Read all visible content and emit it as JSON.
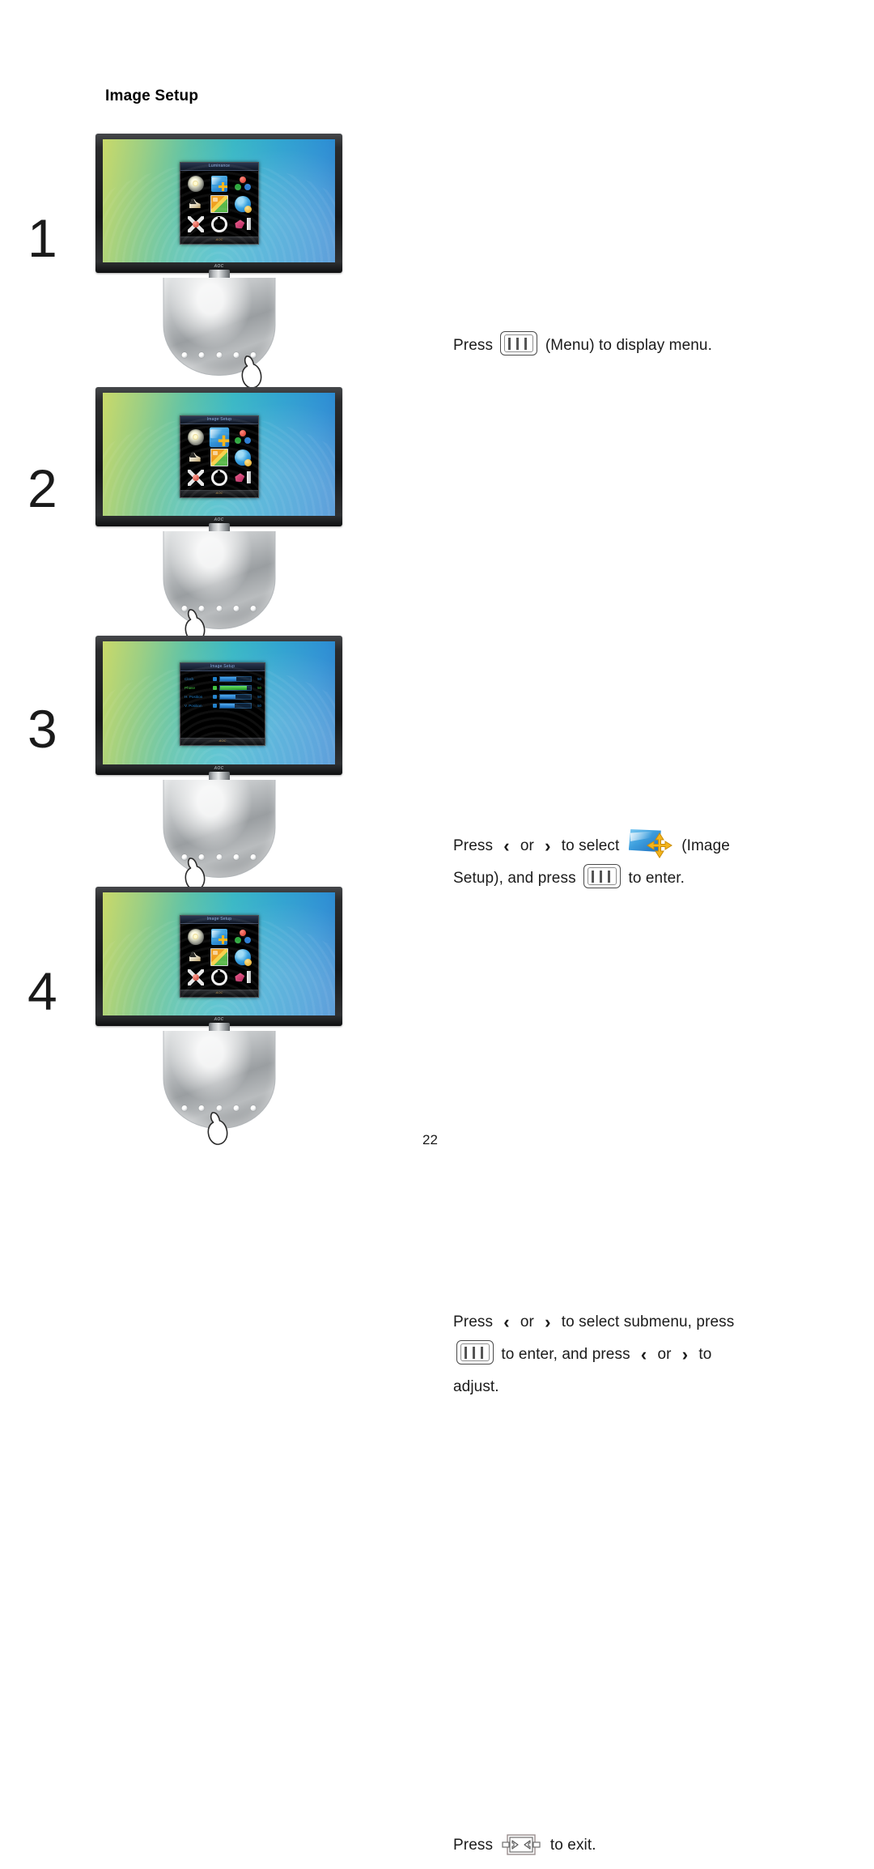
{
  "page": {
    "heading": "Image Setup",
    "number": "22"
  },
  "glyphs": {
    "menu_button": "menu-button-icon",
    "left_arrow": "‹",
    "right_arrow": "›",
    "exit_button": "exit-button-icon",
    "image_setup_icon": "image-setup-icon"
  },
  "steps": [
    {
      "number": "1",
      "lines": [
        [
          {
            "type": "text",
            "value": "Press"
          },
          {
            "type": "icon",
            "value": "menu-button-icon"
          },
          {
            "type": "text",
            "value": "(Menu) to display menu."
          }
        ]
      ],
      "monitor": {
        "osd_type": "icon-grid",
        "osd_title": "Luminance",
        "osd_footer": "AOC",
        "selected_index": -1
      }
    },
    {
      "number": "2",
      "lines": [
        [
          {
            "type": "text",
            "value": "Press"
          },
          {
            "type": "arrow",
            "value": "‹"
          },
          {
            "type": "text",
            "value": "or"
          },
          {
            "type": "arrow",
            "value": "›"
          },
          {
            "type": "text",
            "value": "to select"
          },
          {
            "type": "icon",
            "value": "image-setup-icon"
          },
          {
            "type": "text",
            "value": "(Image"
          }
        ],
        [
          {
            "type": "text",
            "value": "Setup), and press"
          },
          {
            "type": "icon",
            "value": "menu-button-icon"
          },
          {
            "type": "text",
            "value": "to enter."
          }
        ]
      ],
      "monitor": {
        "osd_type": "icon-grid",
        "osd_title": "Image Setup",
        "osd_footer": "AOC",
        "selected_index": 1
      }
    },
    {
      "number": "3",
      "lines": [
        [
          {
            "type": "text",
            "value": "Press"
          },
          {
            "type": "arrow",
            "value": "‹"
          },
          {
            "type": "text",
            "value": "or"
          },
          {
            "type": "arrow",
            "value": "›"
          },
          {
            "type": "text",
            "value": "to select submenu, press"
          }
        ],
        [
          {
            "type": "icon",
            "value": "menu-button-icon"
          },
          {
            "type": "text",
            "value": "to enter, and press"
          },
          {
            "type": "arrow",
            "value": "‹"
          },
          {
            "type": "text",
            "value": "or"
          },
          {
            "type": "arrow",
            "value": "›"
          },
          {
            "type": "text",
            "value": "to"
          }
        ],
        [
          {
            "type": "text",
            "value": "adjust."
          }
        ]
      ],
      "monitor": {
        "osd_type": "submenu",
        "osd_title": "Image Setup",
        "osd_footer": "AOC",
        "submenu_rows": [
          {
            "label": "Clock",
            "value": "50",
            "percent": 52,
            "active": false
          },
          {
            "label": "Phase",
            "value": "50",
            "percent": 74,
            "active": true
          },
          {
            "label": "H. Position",
            "value": "50",
            "percent": 50,
            "active": false
          },
          {
            "label": "V. Position",
            "value": "50",
            "percent": 48,
            "active": false
          }
        ]
      }
    },
    {
      "number": "4",
      "lines": [
        [
          {
            "type": "text",
            "value": "Press"
          },
          {
            "type": "icon",
            "value": "exit-button-icon"
          },
          {
            "type": "text",
            "value": "to exit."
          }
        ]
      ],
      "monitor": {
        "osd_type": "icon-grid",
        "osd_title": "Image Setup",
        "osd_footer": "AOC",
        "selected_index": -1
      }
    }
  ],
  "osd_menu_icons": [
    {
      "name": "luminance",
      "class": "ic-lum"
    },
    {
      "name": "image-setup",
      "class": "ic-imgset"
    },
    {
      "name": "color-setup",
      "class": "ic-color"
    },
    {
      "name": "picture-boost",
      "class": "ic-boost"
    },
    {
      "name": "osd-setup",
      "class": "ic-osdsetup"
    },
    {
      "name": "extra",
      "class": "ic-extra"
    },
    {
      "name": "reset",
      "class": "ic-reset"
    },
    {
      "name": "standby",
      "class": "ic-power"
    },
    {
      "name": "exit",
      "class": "ic-exit"
    }
  ],
  "colors": {
    "accent_blue": "#1f7ec9",
    "accent_green": "#3ec23e",
    "icon_yellow": "#f4b41a",
    "screen_left": "#c9d96a",
    "screen_right": "#2a7fcd"
  }
}
